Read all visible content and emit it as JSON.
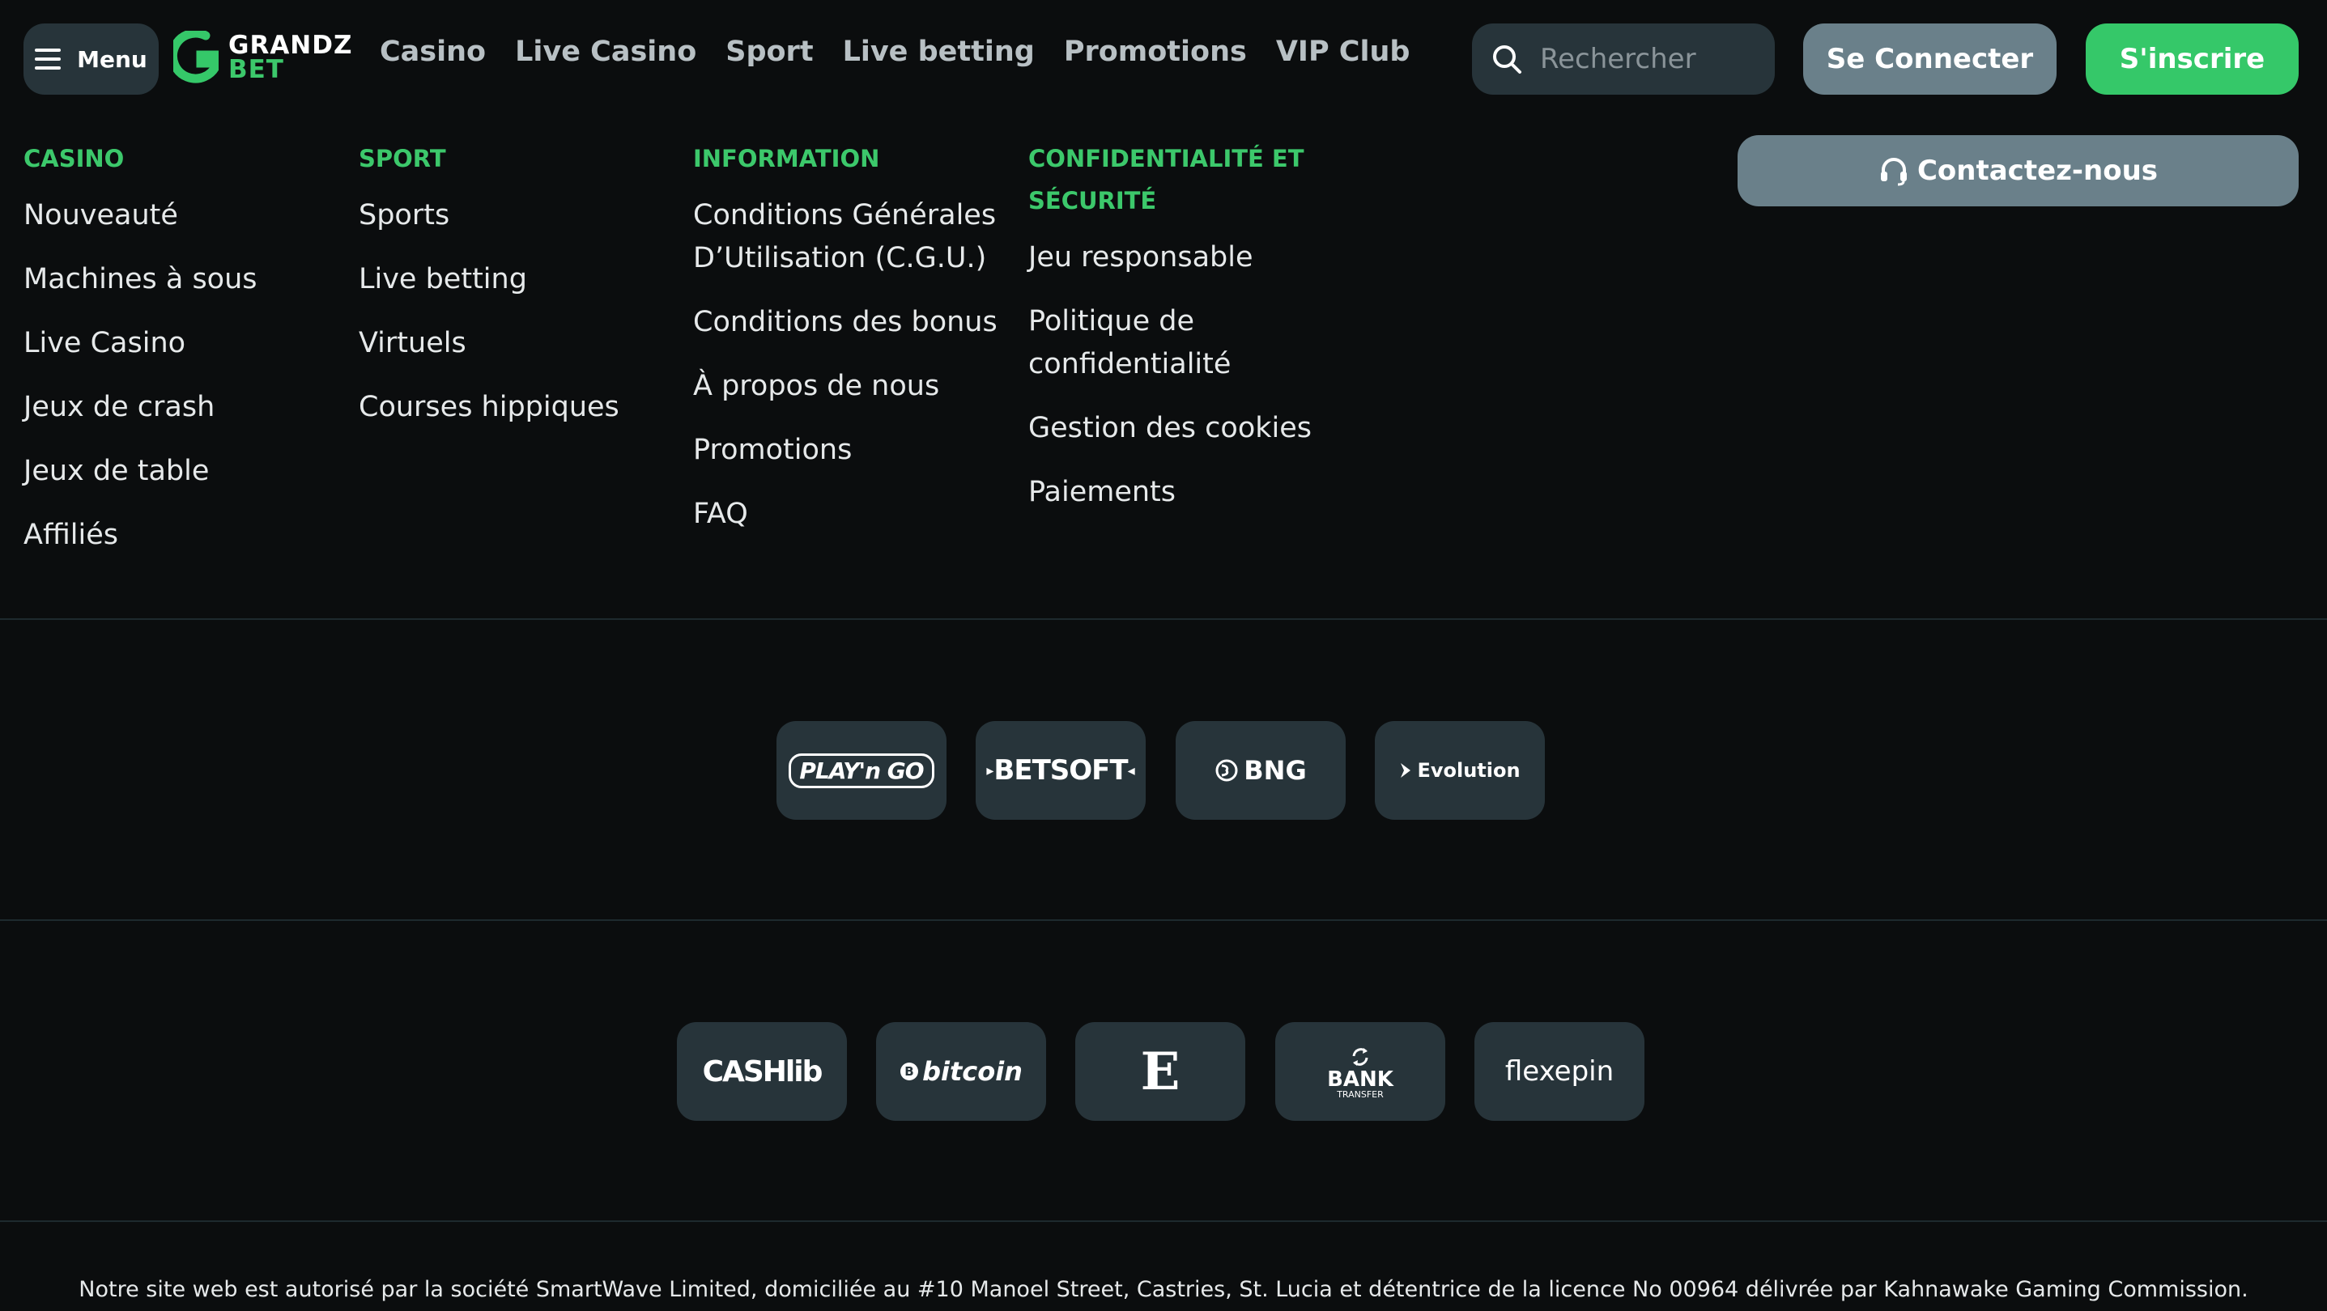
{
  "header": {
    "menu_label": "Menu",
    "logo_top": "GRANDZ",
    "logo_bottom": "BET",
    "nav": [
      "Casino",
      "Live Casino",
      "Sport",
      "Live betting",
      "Promotions",
      "VIP Club"
    ],
    "search_placeholder": "Rechercher",
    "login_label": "Se Connecter",
    "signup_label": "S'inscrire"
  },
  "footer": {
    "columns": [
      {
        "title": "CASINO",
        "links": [
          "Nouveauté",
          "Machines à sous",
          "Live Casino",
          "Jeux de crash",
          "Jeux de table",
          "Affiliés"
        ]
      },
      {
        "title": "SPORT",
        "links": [
          "Sports",
          "Live betting",
          "Virtuels",
          "Courses hippiques"
        ]
      },
      {
        "title": "INFORMATION",
        "links": [
          "Conditions Générales D’Utilisation (C.G.U.)",
          "Conditions des bonus",
          "À propos de nous",
          "Promotions",
          "FAQ"
        ]
      },
      {
        "title": "CONFIDENTIALITÉ ET SÉCURITÉ",
        "links": [
          "Jeu responsable",
          "Politique de confidentialité",
          "Gestion des cookies",
          "Paiements"
        ]
      }
    ],
    "contact_label": "Contactez-nous",
    "providers": [
      "PLAY'n GO",
      "BETSOFT",
      "BNG",
      "Evolution"
    ],
    "payments": [
      "CASHlib",
      "bitcoin",
      "E",
      "BANK",
      "TRANSFER",
      "flexepin"
    ],
    "legal": "Notre site web est autorisé par la société SmartWave Limited, domiciliée au #10 Manoel Street, Castries, St. Lucia et détentrice de la licence No 00964 délivrée par Kahnawake Gaming Commission."
  },
  "colors": {
    "accent": "#35c869",
    "surface": "#27343a",
    "background": "#0b0d0e",
    "secondary_button": "#6a808a"
  }
}
